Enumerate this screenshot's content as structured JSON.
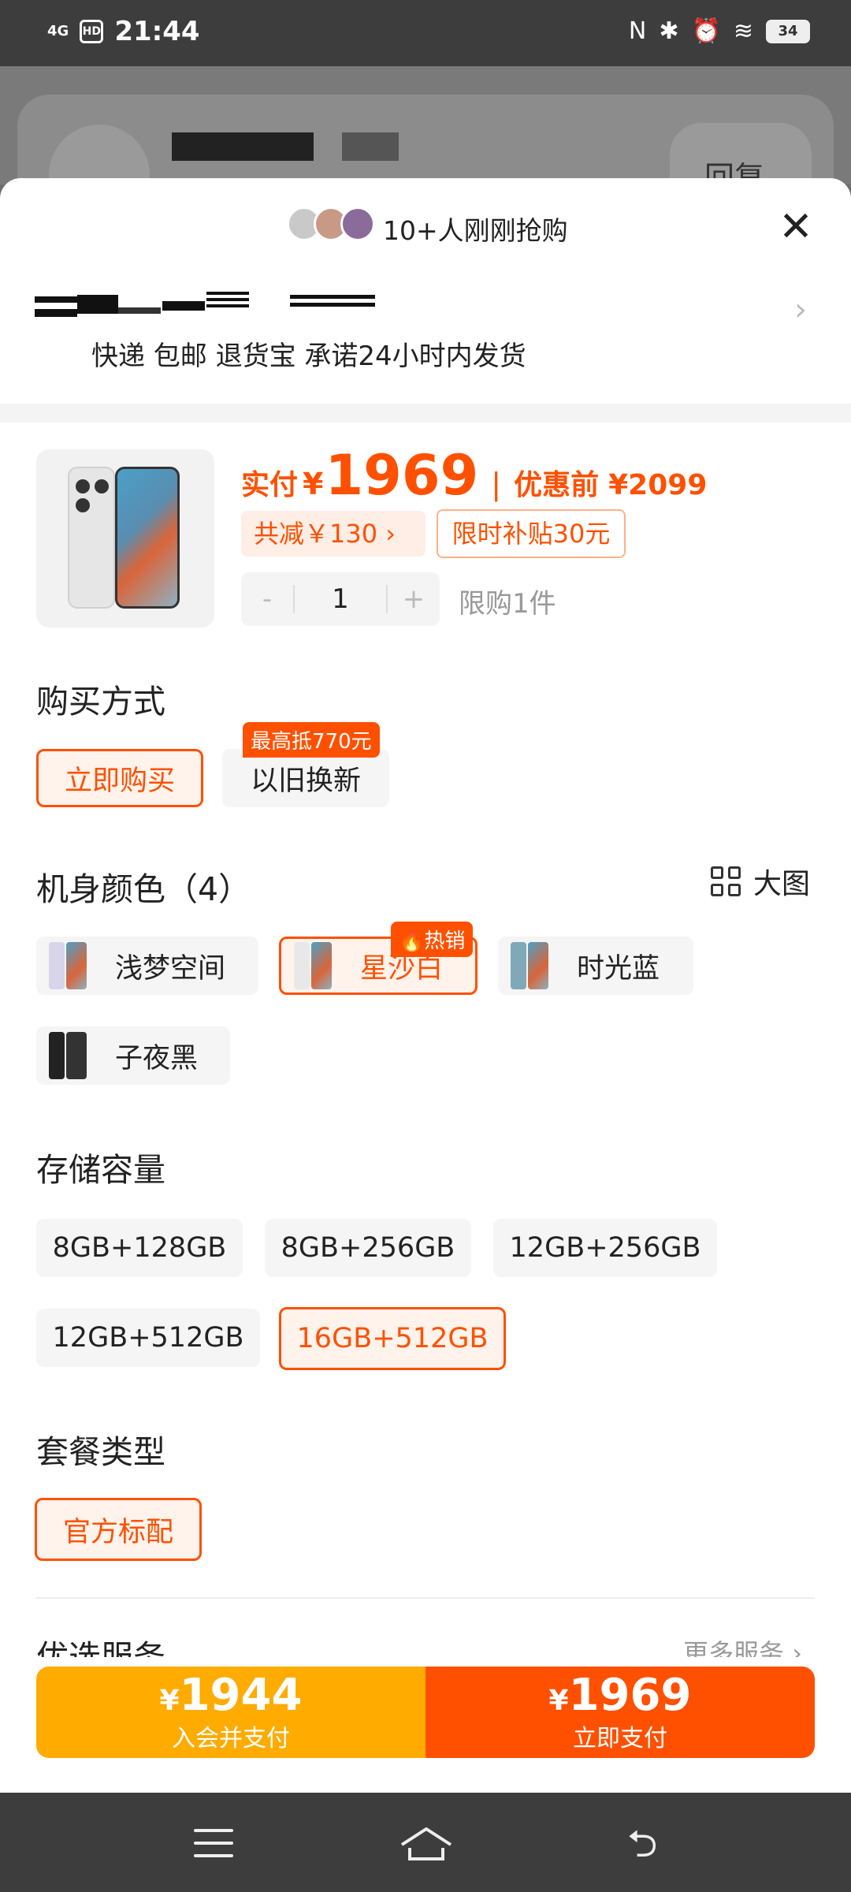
{
  "status_bar": {
    "network": "4G",
    "hd": "HD",
    "time": "21:44",
    "battery": "34"
  },
  "background_page": {
    "reply_button": "回复"
  },
  "sheet": {
    "buyers_text": "10+人刚刚抢购",
    "shipping_text": "快递 包邮 退货宝 承诺24小时内发货",
    "price": {
      "paid_label": "实付",
      "currency": "¥",
      "paid_value": "1969",
      "separator": "|",
      "before_label": "优惠前",
      "before_value": "¥2099"
    },
    "discount_tag": "共减￥130 ›",
    "subsidy_tag": "限时补贴30元",
    "quantity": {
      "minus": "-",
      "value": "1",
      "plus": "+",
      "limit": "限购1件"
    },
    "purchase_method": {
      "title": "购买方式",
      "options": [
        "立即购买",
        "以旧换新"
      ],
      "trade_in_badge": "最高抵770元"
    },
    "color": {
      "title": "机身颜色（4）",
      "big_image_label": "大图",
      "options": [
        "浅梦空间",
        "星沙白",
        "时光蓝",
        "子夜黑"
      ],
      "hot_badge": "🔥热销"
    },
    "storage": {
      "title": "存储容量",
      "options": [
        "8GB+128GB",
        "8GB+256GB",
        "12GB+256GB",
        "12GB+512GB",
        "16GB+512GB"
      ]
    },
    "package": {
      "title": "套餐类型",
      "options": [
        "官方标配"
      ]
    },
    "services": {
      "title": "优选服务",
      "more": "更多服务 ›"
    },
    "pay": {
      "member_price": "1944",
      "member_label": "入会并支付",
      "buy_price": "1969",
      "buy_label": "立即支付",
      "currency": "¥"
    }
  },
  "colors": {
    "accent": "#ff5000",
    "member_button": "#ffab00"
  }
}
